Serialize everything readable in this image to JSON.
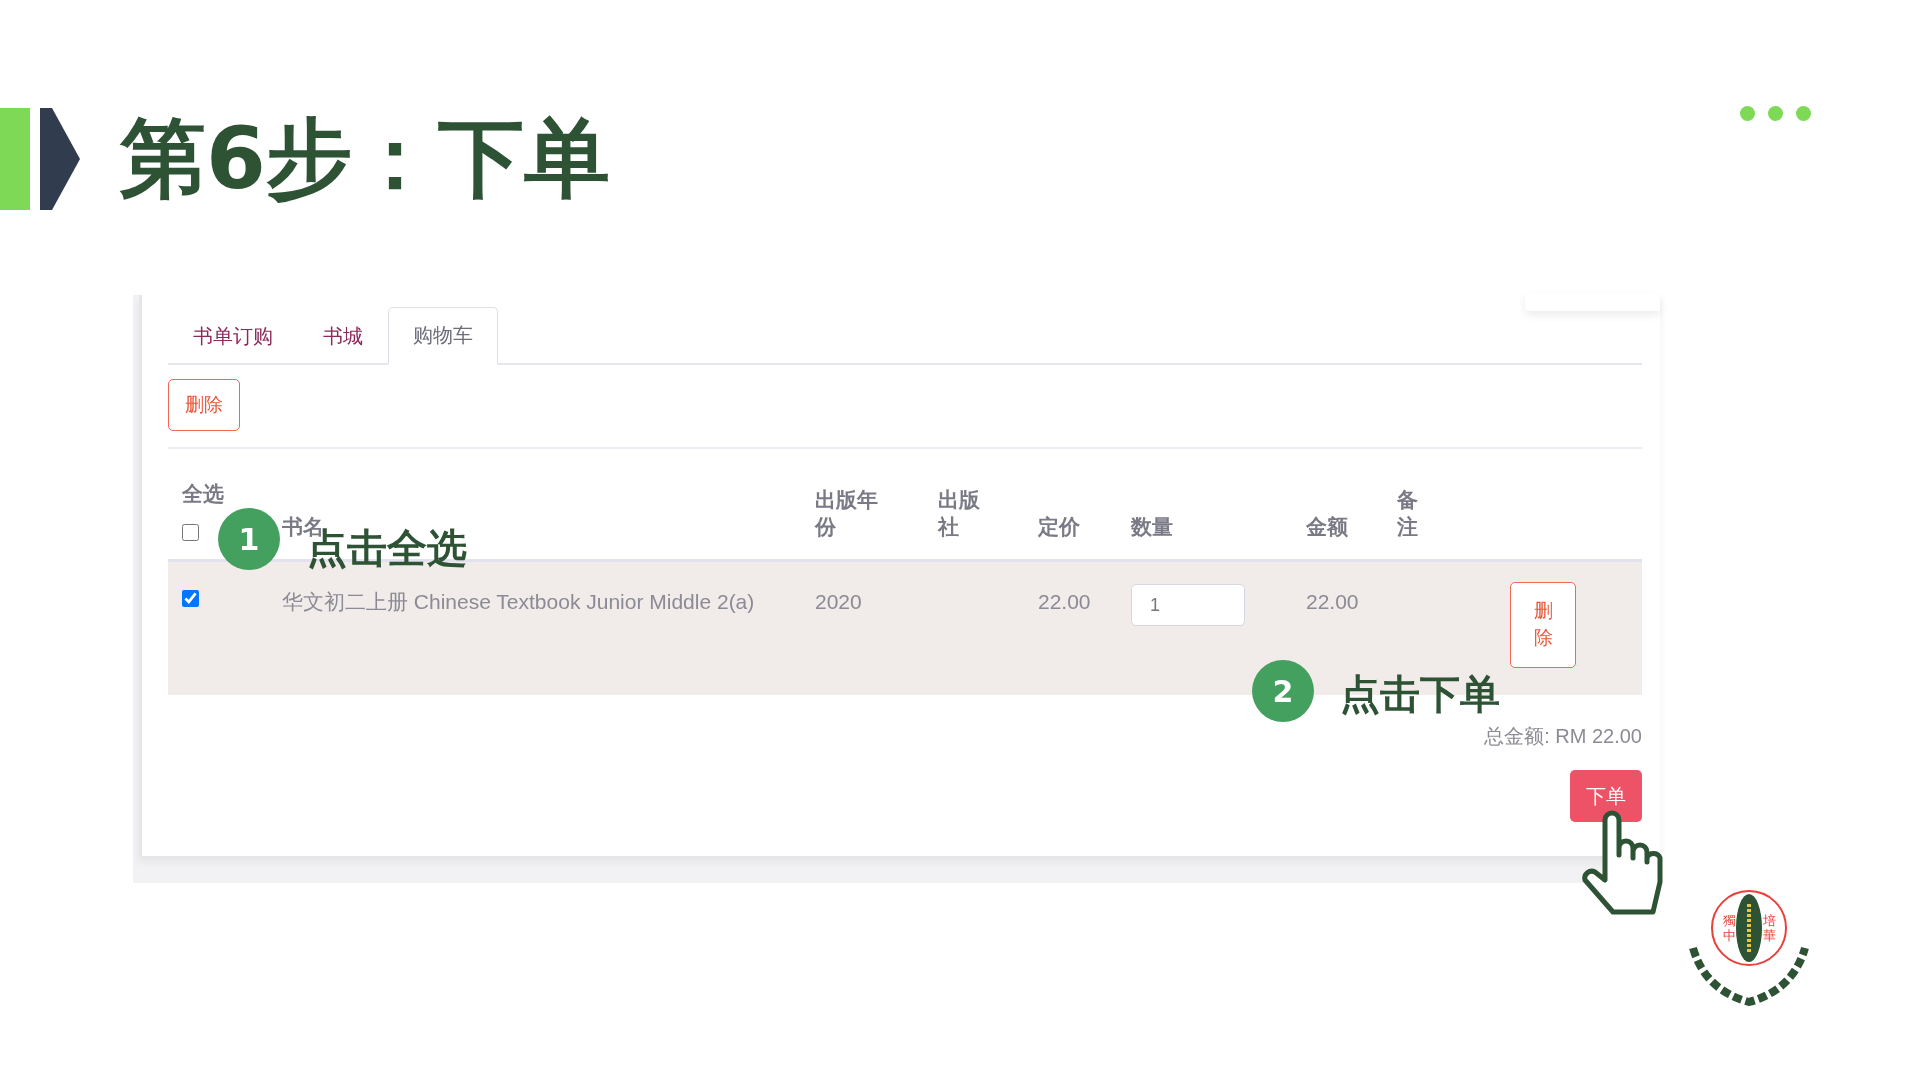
{
  "slide": {
    "title": "第6步：下单"
  },
  "tabs": [
    {
      "label": "书单订购",
      "selected": false
    },
    {
      "label": "书城",
      "selected": false
    },
    {
      "label": "购物车",
      "selected": true
    }
  ],
  "toolbar": {
    "delete_button": "删除"
  },
  "table": {
    "select_all": {
      "label": "全选",
      "checked": false
    },
    "columns": [
      "书名",
      "出版年份",
      "出版社",
      "定价",
      "数量",
      "金额",
      "备注"
    ],
    "rows": [
      {
        "checked": true,
        "title": "华文初二上册 Chinese Textbook Junior Middle 2(a)",
        "year": "2020",
        "price": "22.00",
        "quantity": "1",
        "amount": "22.00",
        "delete_button": "删除"
      }
    ]
  },
  "total": "总金额: RM 22.00",
  "order_button": "下单",
  "annotations": [
    {
      "number": "1",
      "text": "点击全选"
    },
    {
      "number": "2",
      "text": "点击下单"
    }
  ],
  "logo": {
    "left": "獨中",
    "right": "培華"
  }
}
